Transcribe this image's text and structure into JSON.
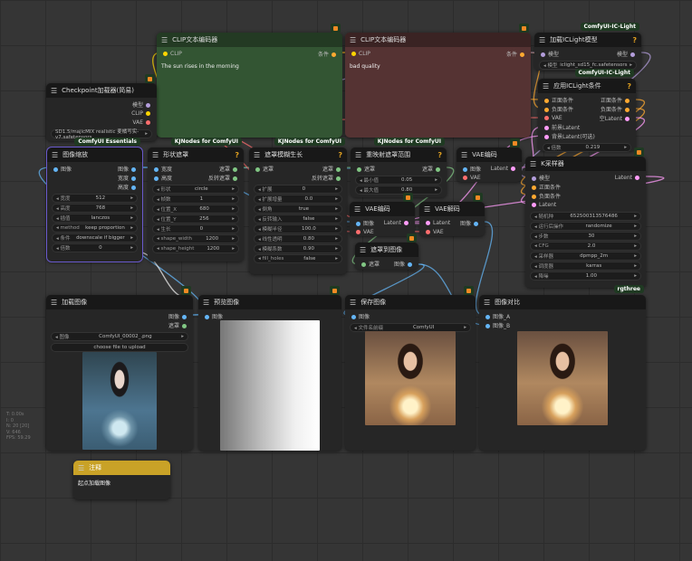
{
  "port_colors": {
    "MODEL": "#b39ddb",
    "CLIP": "#ffd500",
    "VAE": "#ff6e6e",
    "COND": "#ffa931",
    "LATENT": "#ff9cf9",
    "IMAGE": "#64b5f6",
    "MASK": "#81c784",
    "INT": "#64b5f6"
  },
  "node_colors": {
    "clip_pos_body": "#335533",
    "clip_pos_head": "#233a23",
    "clip_neg_body": "#553333",
    "clip_neg_head": "#3a2323",
    "note_head": "#c9a227"
  },
  "nodes": [
    {
      "id": "clip_pos",
      "title": "CLIP文本编码器",
      "fox": true,
      "inputs": [
        {
          "label": "CLIP",
          "type": "CLIP"
        }
      ],
      "outputs": [
        {
          "label": "条件",
          "type": "COND"
        }
      ],
      "text": "The sun rises in the morning"
    },
    {
      "id": "clip_neg",
      "title": "CLIP文本编码器",
      "fox": true,
      "inputs": [
        {
          "label": "CLIP",
          "type": "CLIP"
        }
      ],
      "outputs": [
        {
          "label": "条件",
          "type": "COND"
        }
      ],
      "text": "bad quality"
    },
    {
      "id": "ckpt",
      "title": "Checkpoint加载器(简易)",
      "fox": true,
      "inputs": [],
      "outputs": [
        {
          "label": "模型",
          "type": "MODEL"
        },
        {
          "label": "CLIP",
          "type": "CLIP"
        },
        {
          "label": "VAE",
          "type": "VAE"
        }
      ],
      "widgets": [
        {
          "label": "",
          "value": "SD1.5/majicMIX realistic 麦橘写实-v7.safetensors"
        }
      ]
    },
    {
      "id": "iclight_load",
      "title": "加载ICLight模型",
      "badge": "ComfyUI-IC-Light",
      "help": "?",
      "inputs": [
        {
          "label": "模型",
          "type": "MODEL"
        }
      ],
      "outputs": [
        {
          "label": "模型",
          "type": "MODEL"
        }
      ],
      "widgets": [
        {
          "label": "模型",
          "value": "iclight_sd15_fc.safetensors"
        }
      ]
    },
    {
      "id": "iclight_apply",
      "title": "应用ICLight条件",
      "badge": "ComfyUI-IC-Light",
      "help": "?",
      "inputs": [
        {
          "label": "正面条件",
          "type": "COND"
        },
        {
          "label": "负面条件",
          "type": "COND"
        },
        {
          "label": "VAE",
          "type": "VAE"
        },
        {
          "label": "前景Latent",
          "type": "LATENT"
        },
        {
          "label": "背景Latent(可选)",
          "type": "LATENT"
        }
      ],
      "outputs": [
        {
          "label": "正面条件",
          "type": "COND"
        },
        {
          "label": "负面条件",
          "type": "COND"
        },
        {
          "label": "空Latent",
          "type": "LATENT"
        }
      ],
      "widgets": [
        {
          "label": "倍数",
          "value": "0.219"
        }
      ]
    },
    {
      "id": "resize",
      "title": "图像缩放",
      "badge": "ComfyUI Essentials",
      "selected": true,
      "inputs": [
        {
          "label": "图像",
          "type": "IMAGE"
        }
      ],
      "outputs": [
        {
          "label": "图像",
          "type": "IMAGE"
        },
        {
          "label": "宽度",
          "type": "INT"
        },
        {
          "label": "高度",
          "type": "INT"
        }
      ],
      "widgets": [
        {
          "label": "宽度",
          "value": "512"
        },
        {
          "label": "高度",
          "value": "768"
        },
        {
          "label": "插值",
          "value": "lanczos"
        },
        {
          "label": "method",
          "value": "keep proportion"
        },
        {
          "label": "条件",
          "value": "downscale if bigger"
        },
        {
          "label": "倍数",
          "value": "0"
        }
      ]
    },
    {
      "id": "shape_mask",
      "title": "形状遮罩",
      "badge": "KJNodes for ComfyUI",
      "help": "?",
      "inputs": [
        {
          "label": "宽度",
          "type": "INT"
        },
        {
          "label": "高度",
          "type": "INT"
        }
      ],
      "outputs": [
        {
          "label": "遮罩",
          "type": "MASK"
        },
        {
          "label": "反转遮罩",
          "type": "MASK"
        }
      ],
      "widgets": [
        {
          "label": "形状",
          "value": "circle"
        },
        {
          "label": "帧数",
          "value": "1"
        },
        {
          "label": "位置_X",
          "value": "680"
        },
        {
          "label": "位置_Y",
          "value": "256"
        },
        {
          "label": "生长",
          "value": "0"
        },
        {
          "label": "shape_width",
          "value": "1200"
        },
        {
          "label": "shape_height",
          "value": "1200"
        }
      ]
    },
    {
      "id": "grow_mask",
      "title": "遮罩模糊生长",
      "badge": "KJNodes for ComfyUI",
      "help": "?",
      "inputs": [
        {
          "label": "遮罩",
          "type": "MASK"
        }
      ],
      "outputs": [
        {
          "label": "遮罩",
          "type": "MASK"
        },
        {
          "label": "反转遮罩",
          "type": "MASK"
        }
      ],
      "widgets": [
        {
          "label": "扩展",
          "value": "0"
        },
        {
          "label": "扩展增量",
          "value": "0.0"
        },
        {
          "label": "倒角",
          "value": "true"
        },
        {
          "label": "反转输入",
          "value": "false"
        },
        {
          "label": "模糊半径",
          "value": "100.0"
        },
        {
          "label": "线性透明",
          "value": "0.80"
        },
        {
          "label": "模糊系数",
          "value": "0.90"
        },
        {
          "label": "fill_holes",
          "value": "false"
        }
      ]
    },
    {
      "id": "remap",
      "title": "重映射遮罩范围",
      "badge": "KJNodes for ComfyUI",
      "help": "?",
      "inputs": [
        {
          "label": "遮罩",
          "type": "MASK"
        }
      ],
      "outputs": [
        {
          "label": "遮罩",
          "type": "MASK"
        }
      ],
      "widgets": [
        {
          "label": "最小值",
          "value": "0.05"
        },
        {
          "label": "最大值",
          "value": "0.80"
        }
      ]
    },
    {
      "id": "vae_enc1",
      "title": "VAE编码",
      "fox": true,
      "inputs": [
        {
          "label": "图像",
          "type": "IMAGE"
        },
        {
          "label": "VAE",
          "type": "VAE"
        }
      ],
      "outputs": [
        {
          "label": "Latent",
          "type": "LATENT"
        }
      ]
    },
    {
      "id": "ksampler",
      "title": "K采样器",
      "fox": true,
      "inputs": [
        {
          "label": "模型",
          "type": "MODEL"
        },
        {
          "label": "正面条件",
          "type": "COND"
        },
        {
          "label": "负面条件",
          "type": "COND"
        },
        {
          "label": "Latent",
          "type": "LATENT"
        }
      ],
      "outputs": [
        {
          "label": "Latent",
          "type": "LATENT"
        }
      ],
      "widgets": [
        {
          "label": "随机种",
          "value": "652500313576486"
        },
        {
          "label": "运行后操作",
          "value": "randomize"
        },
        {
          "label": "步数",
          "value": "30"
        },
        {
          "label": "CFG",
          "value": "2.0"
        },
        {
          "label": "采样器",
          "value": "dpmpp_2m"
        },
        {
          "label": "调度器",
          "value": "karras"
        },
        {
          "label": "降噪",
          "value": "1.00"
        }
      ]
    },
    {
      "id": "vae_enc2",
      "title": "VAE编码",
      "fox": true,
      "inputs": [
        {
          "label": "图像",
          "type": "IMAGE"
        },
        {
          "label": "VAE",
          "type": "VAE"
        }
      ],
      "outputs": [
        {
          "label": "Latent",
          "type": "LATENT"
        }
      ]
    },
    {
      "id": "vae_dec",
      "title": "VAE解码",
      "fox": true,
      "inputs": [
        {
          "label": "Latent",
          "type": "LATENT"
        },
        {
          "label": "VAE",
          "type": "VAE"
        }
      ],
      "outputs": [
        {
          "label": "图像",
          "type": "IMAGE"
        }
      ]
    },
    {
      "id": "mask_to_img",
      "title": "遮罩到图像",
      "fox": true,
      "inputs": [
        {
          "label": "遮罩",
          "type": "MASK"
        }
      ],
      "outputs": [
        {
          "label": "图像",
          "type": "IMAGE"
        }
      ]
    },
    {
      "id": "load_image",
      "title": "加载图像",
      "fox": true,
      "inputs": [],
      "outputs": [
        {
          "label": "图像",
          "type": "IMAGE"
        },
        {
          "label": "遮罩",
          "type": "MASK"
        }
      ],
      "widgets": [
        {
          "label": "图像",
          "value": "ComfyUI_00002_.png"
        }
      ],
      "upload": "choose file to upload",
      "image": "original"
    },
    {
      "id": "preview",
      "title": "预览图像",
      "fox": true,
      "inputs": [
        {
          "label": "图像",
          "type": "IMAGE"
        }
      ],
      "outputs": [],
      "image": "mask"
    },
    {
      "id": "save",
      "title": "保存图像",
      "fox": true,
      "inputs": [
        {
          "label": "图像",
          "type": "IMAGE"
        }
      ],
      "outputs": [],
      "widgets": [
        {
          "label": "文件名前缀",
          "value": "ComfyUI"
        }
      ],
      "image": "relit"
    },
    {
      "id": "compare",
      "title": "图像对比",
      "badge": "rgthree",
      "inputs": [
        {
          "label": "图像_A",
          "type": "IMAGE"
        },
        {
          "label": "图像_B",
          "type": "IMAGE"
        }
      ],
      "outputs": [],
      "image": "relit"
    },
    {
      "id": "note",
      "title": "注释",
      "inputs": [],
      "outputs": [],
      "text": "起点加载图像"
    }
  ],
  "stats": [
    "T: 0.00s",
    "I: 0",
    "N: 20 [20]",
    "V: 646",
    "FPS: 59.29"
  ]
}
